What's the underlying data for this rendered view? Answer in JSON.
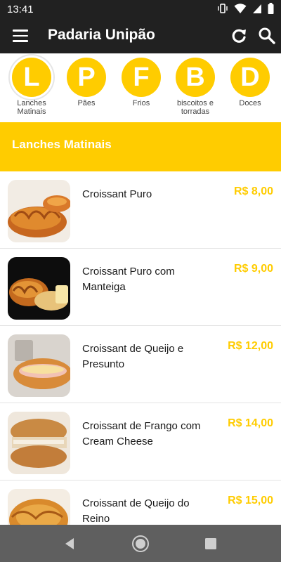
{
  "status_bar": {
    "time": "13:41"
  },
  "app_bar": {
    "title": "Padaria Unipão"
  },
  "categories": [
    {
      "letter": "L",
      "label": "Lanches Matinais"
    },
    {
      "letter": "P",
      "label": "Pães"
    },
    {
      "letter": "F",
      "label": "Frios"
    },
    {
      "letter": "B",
      "label": "biscoitos e torradas"
    },
    {
      "letter": "D",
      "label": "Doces"
    }
  ],
  "section": {
    "title": "Lanches Matinais"
  },
  "products": [
    {
      "name": "Croissant Puro",
      "price": "R$ 8,00"
    },
    {
      "name": "Croissant Puro com Manteiga",
      "price": "R$ 9,00"
    },
    {
      "name": "Croissant de Queijo e Presunto",
      "price": "R$ 12,00"
    },
    {
      "name": "Croissant de Frango com Cream Cheese",
      "price": "R$ 14,00"
    },
    {
      "name": "Croissant de Queijo do Reino",
      "price": "R$ 15,00"
    }
  ],
  "colors": {
    "accent": "#ffcc00",
    "toolbar": "#212121",
    "navbar": "#5f5f5f"
  },
  "icons": {
    "status": [
      "vibrate-icon",
      "wifi-icon",
      "signal-icon",
      "battery-icon"
    ],
    "app_bar": [
      "menu-icon",
      "refresh-icon",
      "search-icon"
    ],
    "nav_bar": [
      "back-icon",
      "home-icon",
      "recents-icon"
    ]
  }
}
